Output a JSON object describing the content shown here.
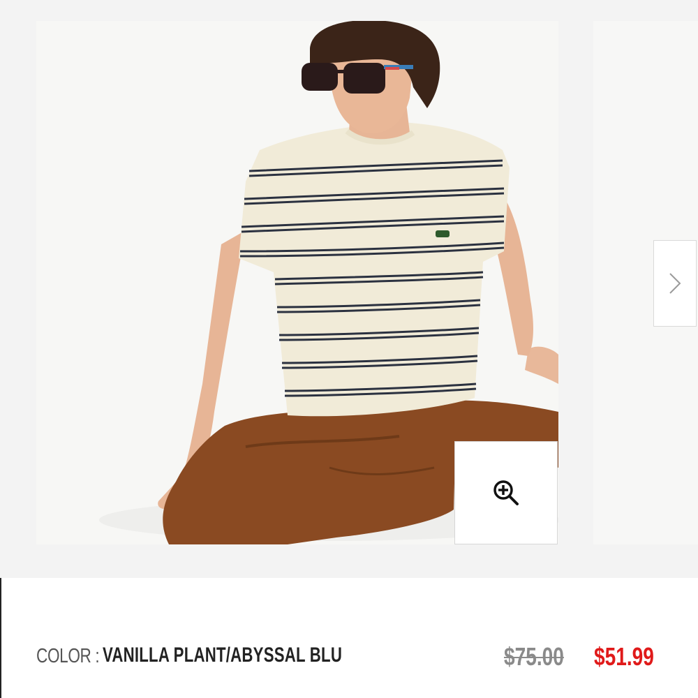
{
  "product": {
    "image_alt": "Man in striped crew neck t-shirt and brown trousers",
    "color_label": "COLOR",
    "color_separator": " : ",
    "color_value": "VANILLA PLANT/ABYSSAL BLU",
    "original_price": "$75.00",
    "sale_price": "$51.99"
  },
  "icons": {
    "zoom": "zoom-in-icon",
    "next": "chevron-right-icon"
  },
  "colors": {
    "gallery_bg": "#f3f3f3",
    "sale_price": "#e01a1a",
    "original_price": "#8a8a8a",
    "color_value": "#222222"
  }
}
